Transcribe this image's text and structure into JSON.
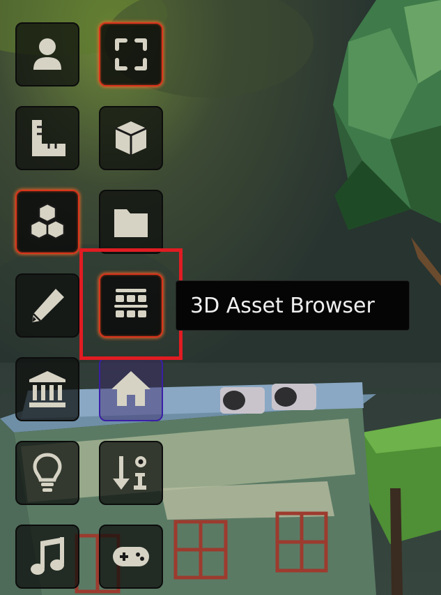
{
  "tooltip": {
    "text": "3D Asset Browser"
  },
  "toolbar": {
    "buttons": [
      {
        "id": "profile",
        "icon": "user-icon",
        "active": false
      },
      {
        "id": "fullscreen",
        "icon": "fullscreen-icon",
        "active": true
      },
      {
        "id": "measure",
        "icon": "ruler-icon",
        "active": false
      },
      {
        "id": "object",
        "icon": "cube-icon",
        "active": false
      },
      {
        "id": "blocks",
        "icon": "cubes-icon",
        "active": true
      },
      {
        "id": "files",
        "icon": "folder-icon",
        "active": false
      },
      {
        "id": "edit",
        "icon": "pencil-icon",
        "active": false
      },
      {
        "id": "asset-browser",
        "icon": "asset-grid-icon",
        "active": true
      },
      {
        "id": "museum",
        "icon": "landmark-icon",
        "active": false
      },
      {
        "id": "home",
        "icon": "home-icon",
        "active": false
      },
      {
        "id": "ideas",
        "icon": "lightbulb-icon",
        "active": false
      },
      {
        "id": "sort-info",
        "icon": "sort-info-icon",
        "active": false
      },
      {
        "id": "music",
        "icon": "music-icon",
        "active": false
      },
      {
        "id": "gamepad",
        "icon": "gamepad-icon",
        "active": false
      }
    ]
  },
  "colors": {
    "icon": "#d6d3c4",
    "active_border": "#d9341c",
    "highlight": "#e01c22",
    "home_border": "#3a1fa6"
  }
}
